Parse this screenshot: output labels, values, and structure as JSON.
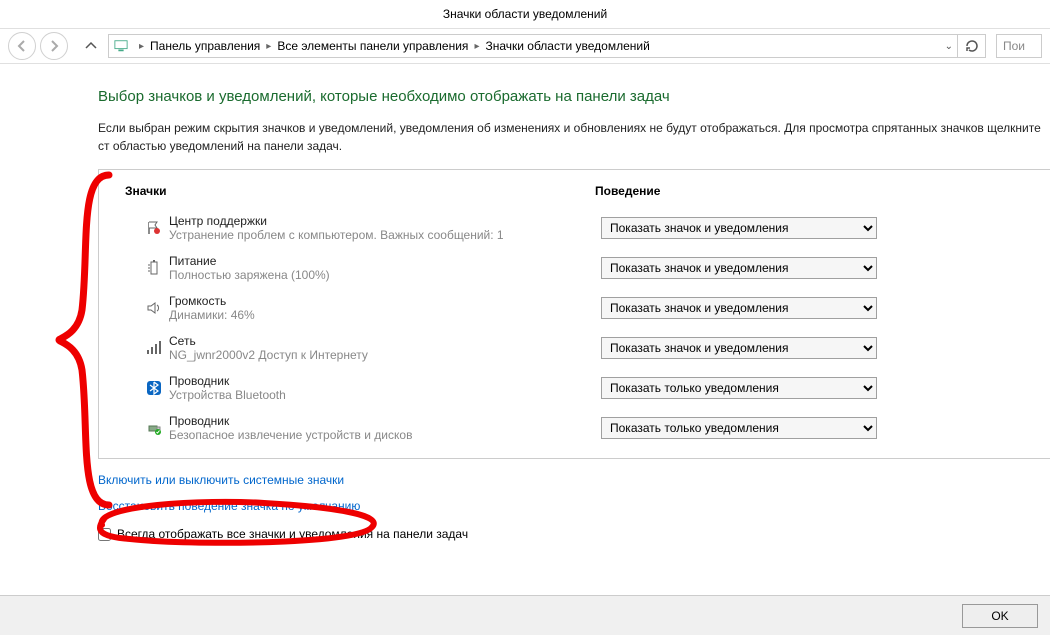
{
  "titlebar": {
    "title": "Значки области уведомлений"
  },
  "nav": {
    "crumb1": "Панель управления",
    "crumb2": "Все элементы панели управления",
    "crumb3": "Значки области уведомлений",
    "search_placeholder": "Пои"
  },
  "main": {
    "heading": "Выбор значков и уведомлений, которые необходимо отображать на панели задач",
    "description": "Если выбран режим скрытия значков и уведомлений, уведомления об изменениях и обновлениях не будут отображаться. Для просмотра спрятанных значков щелкните ст\nобластью уведомлений на панели задач.",
    "col_icons": "Значки",
    "col_behavior": "Поведение",
    "link_system": "Включить или выключить системные значки",
    "link_restore": "Восстановить поведение значка по умолчанию",
    "chk_always": "Всегда отображать все значки и уведомления на панели задач",
    "opt_show_all": "Показать значок и уведомления",
    "opt_notif_only": "Показать только уведомления"
  },
  "items": [
    {
      "title": "Центр поддержки",
      "sub": "Устранение проблем с компьютером. Важных сообщений: 1",
      "icon": "flag",
      "sel": 0
    },
    {
      "title": "Питание",
      "sub": "Полностью заряжена (100%)",
      "icon": "battery",
      "sel": 0
    },
    {
      "title": "Громкость",
      "sub": "Динамики: 46%",
      "icon": "speaker",
      "sel": 0
    },
    {
      "title": "Сеть",
      "sub": "NG_jwnr2000v2 Доступ к Интернету",
      "icon": "network",
      "sel": 0
    },
    {
      "title": "Проводник",
      "sub": "Устройства Bluetooth",
      "icon": "bluetooth",
      "sel": 1
    },
    {
      "title": "Проводник",
      "sub": "Безопасное извлечение устройств и дисков",
      "icon": "usb",
      "sel": 1
    }
  ],
  "footer": {
    "ok": "OK"
  }
}
